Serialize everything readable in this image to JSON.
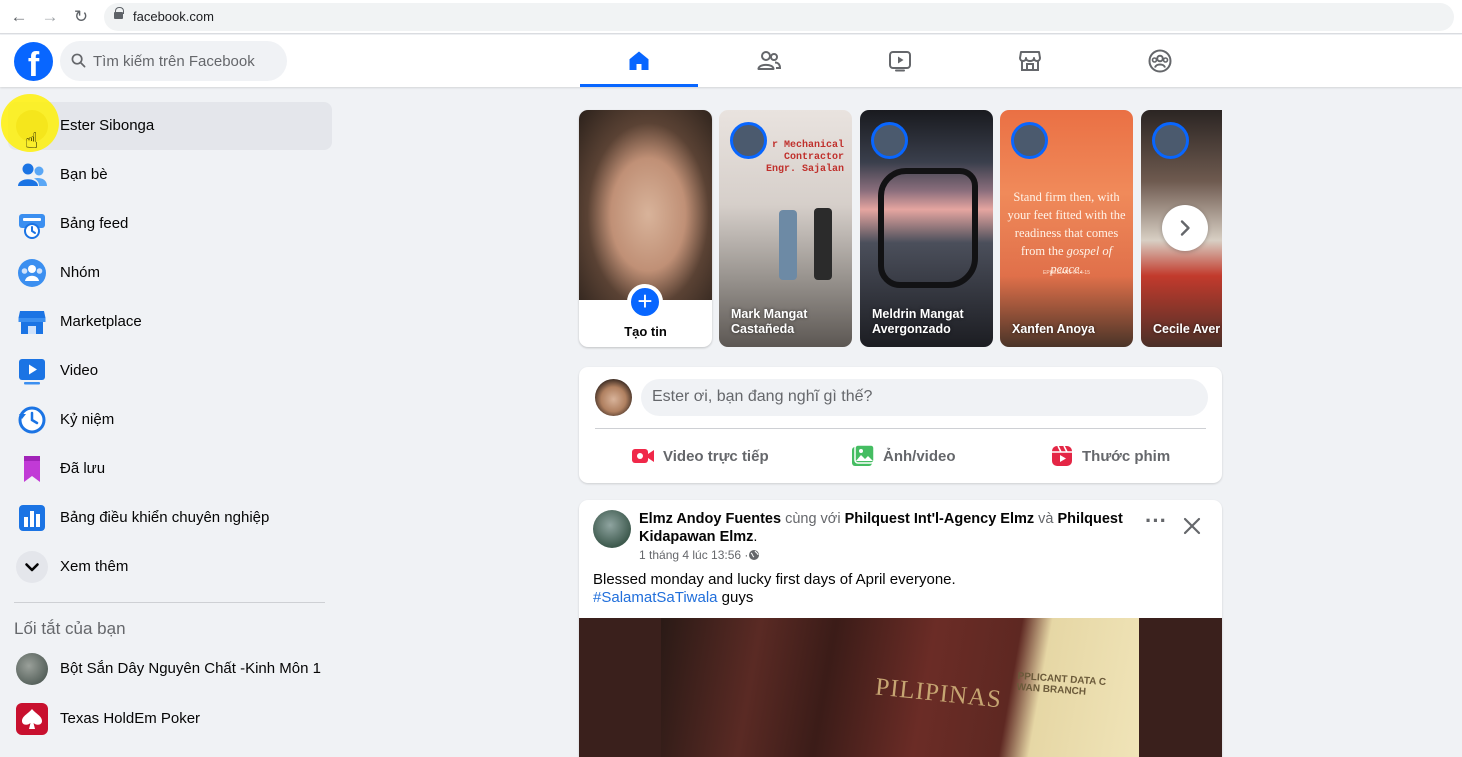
{
  "browser": {
    "url": "facebook.com",
    "back_icon": "←",
    "forward_icon": "→",
    "reload_icon": "↻"
  },
  "header": {
    "logo": "f",
    "search_placeholder": "Tìm kiếm trên Facebook",
    "tabs": [
      "home",
      "friends",
      "watch",
      "marketplace",
      "groups"
    ],
    "active_tab": "home",
    "accent_color": "#0866ff"
  },
  "sidebar": {
    "items": [
      {
        "label": "Ester Sibonga",
        "icon": "profile-avatar"
      },
      {
        "label": "Bạn bè",
        "icon": "friends-icon"
      },
      {
        "label": "Bảng feed",
        "icon": "feed-icon"
      },
      {
        "label": "Nhóm",
        "icon": "groups-icon"
      },
      {
        "label": "Marketplace",
        "icon": "marketplace-icon"
      },
      {
        "label": "Video",
        "icon": "video-icon"
      },
      {
        "label": "Kỷ niệm",
        "icon": "memories-icon"
      },
      {
        "label": "Đã lưu",
        "icon": "saved-icon"
      },
      {
        "label": "Bảng điều khiển chuyên nghiệp",
        "icon": "dashboard-icon"
      },
      {
        "label": "Xem thêm",
        "icon": "chevron-down-icon"
      }
    ],
    "shortcuts_title": "Lối tắt của bạn",
    "shortcuts": [
      {
        "label": "Bột Sắn Dây Nguyên Chất -Kinh Môn 1"
      },
      {
        "label": "Texas HoldEm Poker"
      }
    ]
  },
  "stories": {
    "create_label": "Tạo tin",
    "items": [
      {
        "name": "Mark Mangat Castañeda",
        "overlay": "r Mechanical\nContractor\nEngr. Sajalan"
      },
      {
        "name": "Meldrin Mangat Avergonzado"
      },
      {
        "name": "Xanfen Anoya",
        "quote_plain": "Stand firm then, with your feet fitted with the readiness that comes from the ",
        "quote_em": "gospel of peace.",
        "quote_ref": "EPHESIANS 6:14-15"
      },
      {
        "name": "Cecile Aver"
      }
    ]
  },
  "composer": {
    "placeholder": "Ester ơi, bạn đang nghĩ gì thế?",
    "actions": [
      {
        "label": "Video trực tiếp",
        "color": "#f02849"
      },
      {
        "label": "Ảnh/video",
        "color": "#45bd62"
      },
      {
        "label": "Thước phim",
        "color": "#e42645"
      }
    ]
  },
  "post": {
    "author": "Elmz Andoy Fuentes",
    "with_text": " cùng với ",
    "tag1": "Philquest Int'l-Agency Elmz",
    "and_text": " và ",
    "tag2": "Philquest Kidapawan Elmz",
    "period": ".",
    "time": "1 tháng 4 lúc 13:56 · ",
    "text": "Blessed monday and lucky  first days of April everyone.",
    "hashtag": "#SalamatSaTiwala",
    "text_after": " guys",
    "image_text": "PILIPINAS",
    "image_text2": "PPLICANT DATA C\nWAN BRANCH"
  }
}
